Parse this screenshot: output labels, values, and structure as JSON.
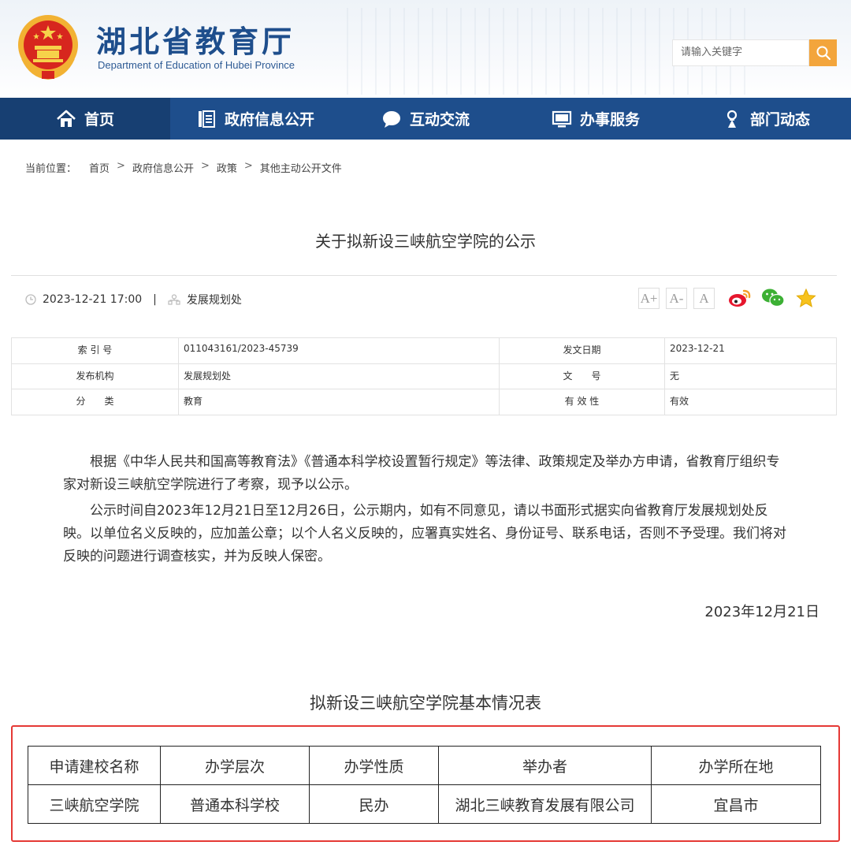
{
  "header": {
    "site_title": "湖北省教育厅",
    "site_subtitle": "Department of Education of Hubei Province",
    "search_placeholder": "请输入关键字"
  },
  "nav": [
    {
      "label": "首页",
      "icon": "home-icon"
    },
    {
      "label": "政府信息公开",
      "icon": "document-icon"
    },
    {
      "label": "互动交流",
      "icon": "chat-bubble-icon"
    },
    {
      "label": "办事服务",
      "icon": "monitor-icon"
    },
    {
      "label": "部门动态",
      "icon": "person-badge-icon"
    }
  ],
  "breadcrumb": {
    "label": "当前位置：",
    "items": [
      "首页",
      "政府信息公开",
      "政策",
      "其他主动公开文件"
    ],
    "separator": ">"
  },
  "article": {
    "title": "关于拟新设三峡航空学院的公示",
    "datetime": "2023-12-21 17:00",
    "meta_separator": "|",
    "department": "发展规划处",
    "font_sizes": [
      "A+",
      "A-",
      "A"
    ]
  },
  "info": {
    "row1": {
      "k1": "索 引 号",
      "v1": "011043161/2023-45739",
      "k2": "发文日期",
      "v2": "2023-12-21"
    },
    "row2": {
      "k1": "发布机构",
      "v1": "发展规划处",
      "k2": "文　　号",
      "v2": "无"
    },
    "row3": {
      "k1": "分　　类",
      "v1": "教育",
      "k2": "有 效 性",
      "v2": "有效"
    }
  },
  "content": {
    "p1": "根据《中华人民共和国高等教育法》《普通本科学校设置暂行规定》等法律、政策规定及举办方申请，省教育厅组织专家对新设三峡航空学院进行了考察，现予以公示。",
    "p2": "公示时间自2023年12月21日至12月26日，公示期内，如有不同意见，请以书面形式据实向省教育厅发展规划处反映。以单位名义反映的，应加盖公章；以个人名义反映的，应署真实姓名、身份证号、联系电话，否则不予受理。我们将对反映的问题进行调查核实，并为反映人保密。",
    "date": "2023年12月21日"
  },
  "basic_table": {
    "title": "拟新设三峡航空学院基本情况表",
    "headers": [
      "申请建校名称",
      "办学层次",
      "办学性质",
      "举办者",
      "办学所在地"
    ],
    "row": [
      "三峡航空学院",
      "普通本科学校",
      "民办",
      "湖北三峡教育发展有限公司",
      "宜昌市"
    ]
  },
  "colors": {
    "nav_bg": "#1e4e8c",
    "nav_active": "#173f72",
    "search_button": "#f3a53c",
    "highlight_border": "#e53935"
  }
}
